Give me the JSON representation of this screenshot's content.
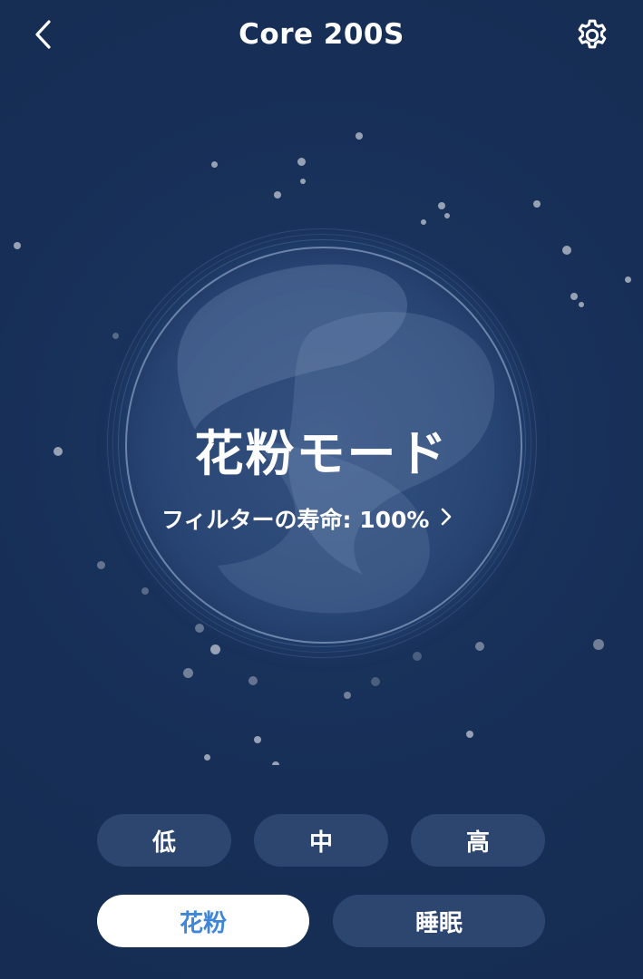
{
  "header": {
    "title": "Core 200S",
    "back_icon": "chevron-left-icon",
    "settings_icon": "gear-icon"
  },
  "status": {
    "mode_title": "花粉モード",
    "filter_life_label": "フィルターの寿命: 100%",
    "filter_life_percent": 100,
    "chevron_icon": "chevron-right-icon"
  },
  "fan_speed": {
    "low": "低",
    "medium": "中",
    "high": "高"
  },
  "modes": {
    "pollen": "花粉",
    "sleep": "睡眠",
    "selected": "pollen"
  },
  "colors": {
    "background": "#172f57",
    "button_bg": "#2c4670",
    "accent_text": "#3f86d9",
    "active_bg": "#ffffff"
  }
}
